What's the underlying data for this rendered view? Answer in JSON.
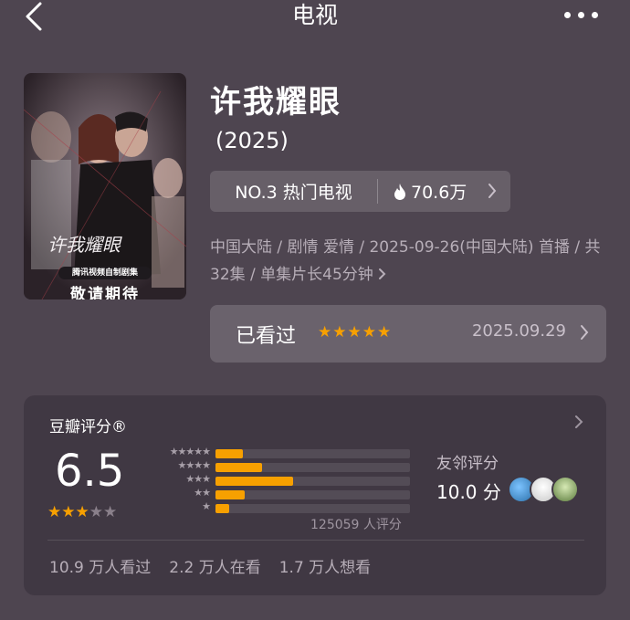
{
  "header": {
    "title": "电视",
    "back_icon": "chevron-left-icon",
    "more_icon": "more-horizontal-icon"
  },
  "poster": {
    "title_art": "许我耀眼",
    "caption": "腾讯视频自制剧集",
    "tagline": "敬请期待"
  },
  "show": {
    "title": "许我耀眼",
    "year": "(2025)",
    "rank": "NO.3 热门电视",
    "heat": "70.6万",
    "meta": "中国大陆 / 剧情 爱情 / 2025-09-26(中国大陆) 首播 / 共32集 / 单集片长45分钟"
  },
  "watched": {
    "label": "已看过",
    "rating_stars": 5,
    "stars_text": "★★★★★",
    "date": "2025.09.29"
  },
  "douban": {
    "title": "豆瓣评分®",
    "score": "6.5",
    "score_stars_on": 3,
    "distribution": [
      {
        "stars": "★★★★★",
        "fraction": 0.14
      },
      {
        "stars": "★★★★",
        "fraction": 0.24
      },
      {
        "stars": "★★★",
        "fraction": 0.4
      },
      {
        "stars": "★★",
        "fraction": 0.15
      },
      {
        "stars": "★",
        "fraction": 0.07
      }
    ],
    "votes": "125059 人评分",
    "friends_title": "友邻评分",
    "friends_score": "10.0 分",
    "counts": {
      "watched": "10.9 万人看过",
      "watching": "2.2 万人在看",
      "want": "1.7 万人想看"
    }
  },
  "colors": {
    "accent": "#f7a000",
    "background": "#4e4550",
    "card": "#403843"
  }
}
